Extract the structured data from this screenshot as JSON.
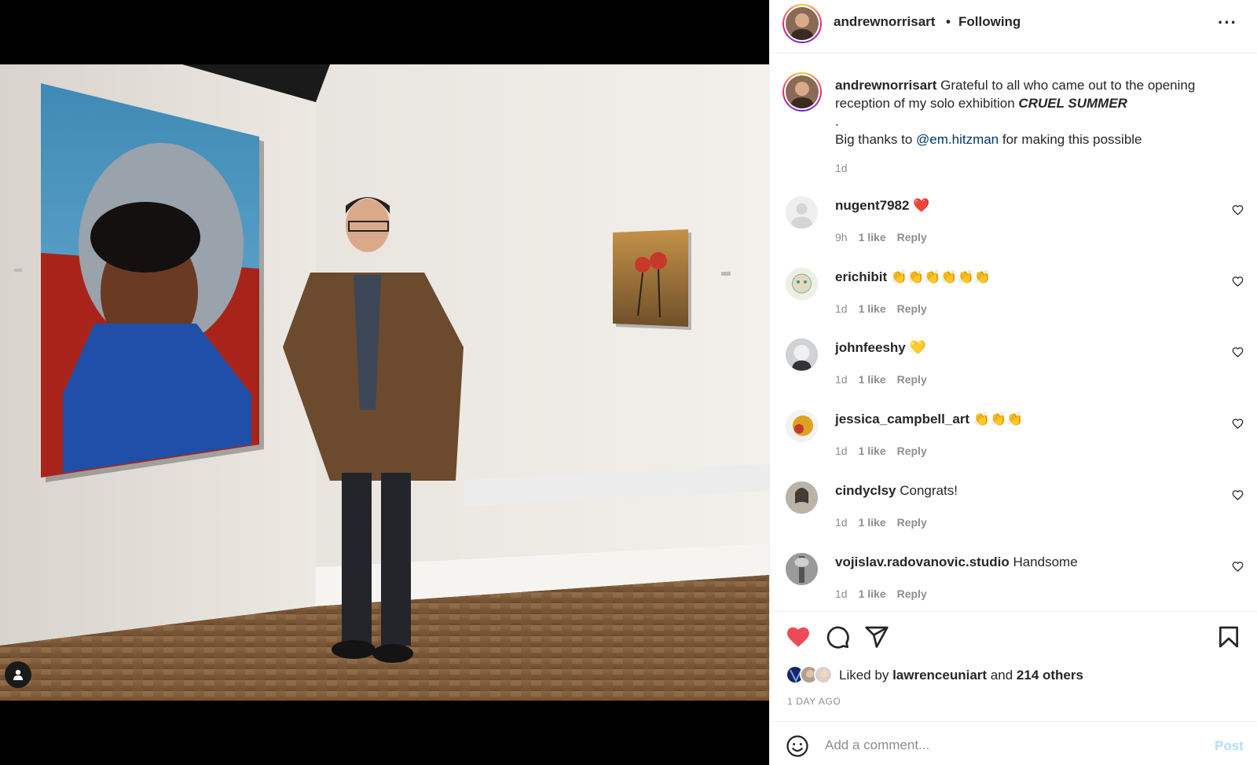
{
  "post": {
    "author": "andrewnorrisart",
    "separator": "•",
    "follow_status": "Following",
    "more_label": "···"
  },
  "caption": {
    "username": "andrewnorrisart",
    "text_part1": "Grateful to all who came out to the opening reception of my solo exhibition",
    "exhibition": "CRUEL SUMMER",
    "dot_line": ".",
    "thanks_prefix": "Big thanks to",
    "mention": "@em.hitzman",
    "thanks_suffix": "for making this possible",
    "time": "1d"
  },
  "comments": [
    {
      "username": "nugent7982",
      "text": "❤️",
      "time": "9h",
      "likes": "1 like",
      "reply": "Reply"
    },
    {
      "username": "erichibit",
      "text": "👏👏👏👏👏👏",
      "time": "1d",
      "likes": "1 like",
      "reply": "Reply"
    },
    {
      "username": "johnfeeshy",
      "text": "💛",
      "time": "1d",
      "likes": "1 like",
      "reply": "Reply"
    },
    {
      "username": "jessica_campbell_art",
      "text": "👏👏👏",
      "time": "1d",
      "likes": "1 like",
      "reply": "Reply"
    },
    {
      "username": "cindyclsy",
      "text": "Congrats!",
      "time": "1d",
      "likes": "1 like",
      "reply": "Reply"
    },
    {
      "username": "vojislav.radovanovic.studio",
      "text": "Handsome",
      "time": "1d",
      "likes": "1 like",
      "reply": "Reply"
    }
  ],
  "likes": {
    "prefix": "Liked by",
    "liked_by_user": "lawrenceuniart",
    "and_word": "and",
    "others": "214 others"
  },
  "post_age": "1 DAY AGO",
  "add_comment": {
    "placeholder": "Add a comment...",
    "post_label": "Post"
  },
  "colors": {
    "like_red": "#ed4956",
    "mention_blue": "#00376b",
    "post_disabled": "#b2dffc",
    "secondary_text": "#8e8e8e"
  },
  "icons": {
    "like": "heart-filled-icon",
    "comment": "comment-bubble-icon",
    "share": "paper-plane-icon",
    "save": "bookmark-icon",
    "emoji": "smiley-icon",
    "tag": "user-tag-icon",
    "more": "more-options-icon"
  }
}
